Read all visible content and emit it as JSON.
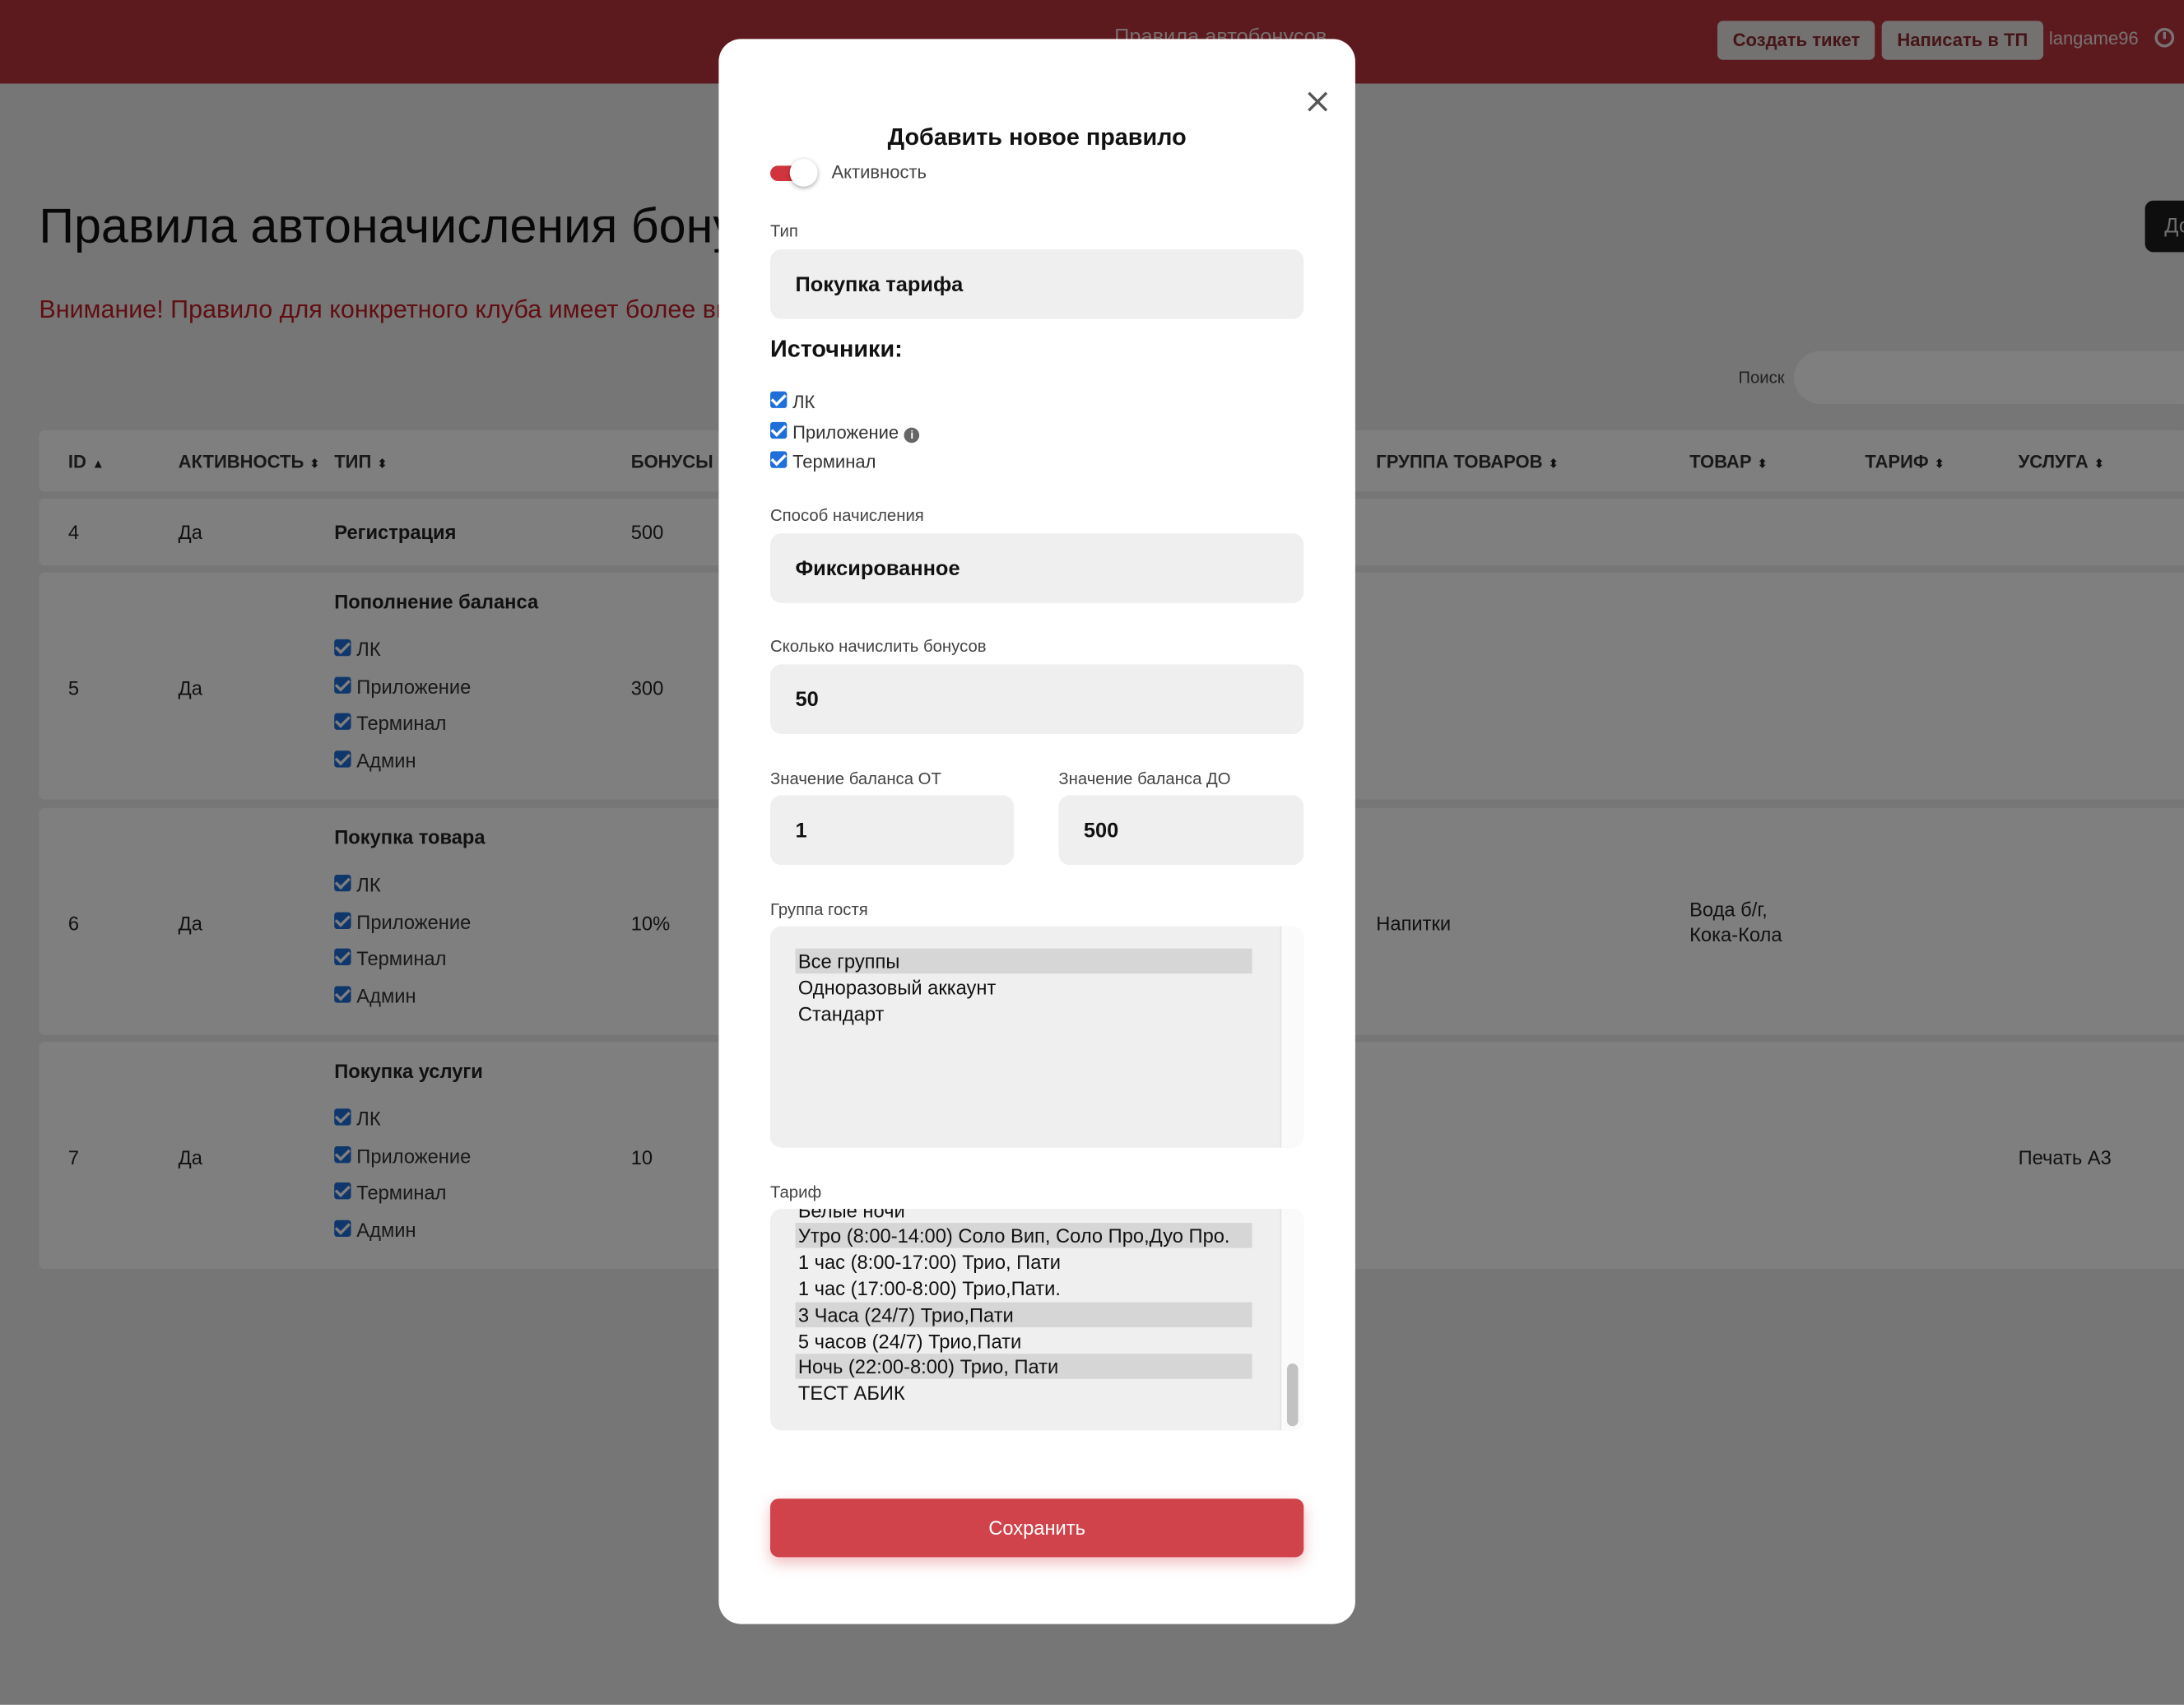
{
  "header": {
    "center_title": "Правила автобонусов",
    "create_ticket": "Создать тикет",
    "write_support": "Написать в ТП",
    "username": "langame96"
  },
  "page": {
    "title": "Правила автоначисления бонусов",
    "warning": "Внимание! Правило для конкретного клуба имеет более высокий приоритет",
    "add_button": "До",
    "search_label": "Поиск"
  },
  "table": {
    "columns": [
      "ID",
      "АКТИВНОСТЬ",
      "ТИП",
      "БОНУСЫ",
      "ГРУППА ТОВАРОВ",
      "ТОВАР",
      "ТАРИФ",
      "УСЛУГА"
    ],
    "source_labels": [
      "ЛК",
      "Приложение",
      "Терминал",
      "Админ"
    ],
    "rows": [
      {
        "id": "4",
        "active": "Да",
        "type": "Регистрация",
        "bonus": "500",
        "product_group": "",
        "product": "",
        "tariff": "",
        "service": ""
      },
      {
        "id": "5",
        "active": "Да",
        "type": "Пополнение баланса",
        "bonus": "300",
        "product_group": "",
        "product": "",
        "tariff": "",
        "service": ""
      },
      {
        "id": "6",
        "active": "Да",
        "type": "Покупка товара",
        "bonus": "10%",
        "product_group": "Напитки",
        "product": "Вода б/г,",
        "product_2": "Кока-Кола",
        "tariff": "",
        "service": ""
      },
      {
        "id": "7",
        "active": "Да",
        "type": "Покупка услуги",
        "bonus": "10",
        "product_group": "",
        "product": "",
        "tariff": "",
        "service": "Печать А3"
      }
    ]
  },
  "modal": {
    "title": "Добавить новое правило",
    "activity_label": "Активность",
    "activity_on": true,
    "type_label": "Тип",
    "type_value": "Покупка тарифа",
    "sources_heading": "Источники:",
    "sources": [
      {
        "label": "ЛК",
        "checked": true
      },
      {
        "label": "Приложение",
        "checked": true
      },
      {
        "label": "Терминал",
        "checked": true
      }
    ],
    "method_label": "Способ начисления",
    "method_value": "Фиксированное",
    "bonus_amount_label": "Сколько начислить бонусов",
    "bonus_amount_value": "50",
    "balance_from_label": "Значение баланса ОТ",
    "balance_from_value": "1",
    "balance_to_label": "Значение баланса ДО",
    "balance_to_value": "500",
    "guest_group_label": "Группа гостя",
    "guest_groups": [
      {
        "label": "Все группы",
        "selected": true
      },
      {
        "label": "Одноразовый аккаунт",
        "selected": false
      },
      {
        "label": "Стандарт",
        "selected": false
      }
    ],
    "tariff_label": "Тариф",
    "tariffs": [
      {
        "label": "Белые ночи",
        "selected": false
      },
      {
        "label": "Утро (8:00-14:00) Соло Вип, Соло Про,Дуо Про.",
        "selected": true
      },
      {
        "label": "1 час (8:00-17:00) Трио, Пати",
        "selected": false
      },
      {
        "label": "1 час (17:00-8:00) Трио,Пати.",
        "selected": false
      },
      {
        "label": "3 Часа (24/7) Трио,Пати",
        "selected": true
      },
      {
        "label": "5 часов (24/7) Трио,Пати",
        "selected": false
      },
      {
        "label": "Ночь (22:00-8:00) Трио, Пати",
        "selected": true
      },
      {
        "label": "ТЕСТ АБИК",
        "selected": false
      }
    ],
    "save_label": "Сохранить"
  },
  "colors": {
    "header_bg": "#b8353c",
    "accent_red": "#d1434a",
    "warning_red": "#c21d24",
    "checkbox_blue": "#1e6fd9"
  }
}
